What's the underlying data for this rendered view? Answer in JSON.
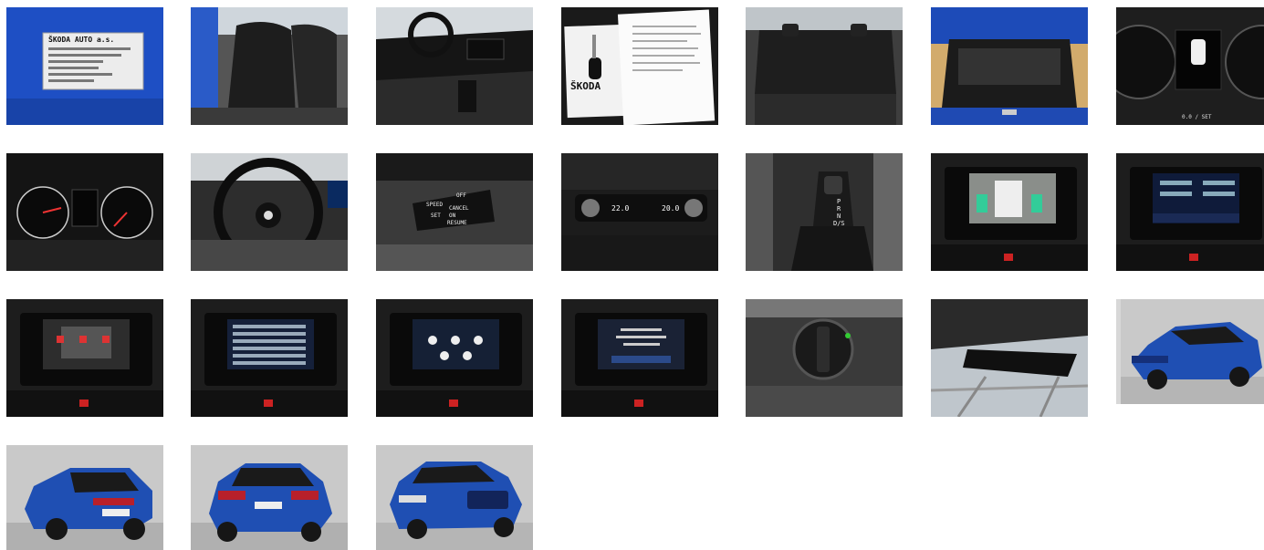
{
  "gallery": {
    "thumbs": [
      {
        "id": 1,
        "subject": "vin-plate",
        "plate_text": [
          "ŠKODA AUTO a.s."
        ]
      },
      {
        "id": 2,
        "subject": "front-seats"
      },
      {
        "id": 3,
        "subject": "dashboard-interior"
      },
      {
        "id": 4,
        "subject": "keys-and-documents",
        "logo_text": "ŠKODA"
      },
      {
        "id": 5,
        "subject": "rear-seats"
      },
      {
        "id": 6,
        "subject": "trunk"
      },
      {
        "id": 7,
        "subject": "instrument-cluster-right",
        "readout": "0.0 / SET"
      },
      {
        "id": 8,
        "subject": "instrument-cluster"
      },
      {
        "id": 9,
        "subject": "steering-wheel"
      },
      {
        "id": 10,
        "subject": "cruise-control-stalk",
        "stalk_text": [
          "SPEED",
          "CANCEL",
          "ON",
          "RESUME",
          "OFF",
          "SET"
        ]
      },
      {
        "id": 11,
        "subject": "climate-control",
        "temps": [
          "22.0",
          "20.0"
        ]
      },
      {
        "id": 12,
        "subject": "gear-shifter",
        "gears": [
          "P",
          "R",
          "N",
          "D/S"
        ]
      },
      {
        "id": 13,
        "subject": "parking-camera-screen"
      },
      {
        "id": 14,
        "subject": "infotainment-radio"
      },
      {
        "id": 15,
        "subject": "infotainment-car-settings"
      },
      {
        "id": 16,
        "subject": "infotainment-settings-menu"
      },
      {
        "id": 17,
        "subject": "infotainment-home"
      },
      {
        "id": 18,
        "subject": "infotainment-message"
      },
      {
        "id": 19,
        "subject": "headlight-switch"
      },
      {
        "id": 20,
        "subject": "rear-view-mirror"
      },
      {
        "id": 21,
        "subject": "car-front-three-quarter"
      },
      {
        "id": 22,
        "subject": "car-rear-three-quarter"
      },
      {
        "id": 23,
        "subject": "car-rear-view"
      },
      {
        "id": 24,
        "subject": "car-front-view"
      }
    ]
  },
  "colors": {
    "car_blue": "#1f4fb3",
    "interior_dark": "#1a1a1a",
    "studio_bg": "#c9c9c9"
  }
}
